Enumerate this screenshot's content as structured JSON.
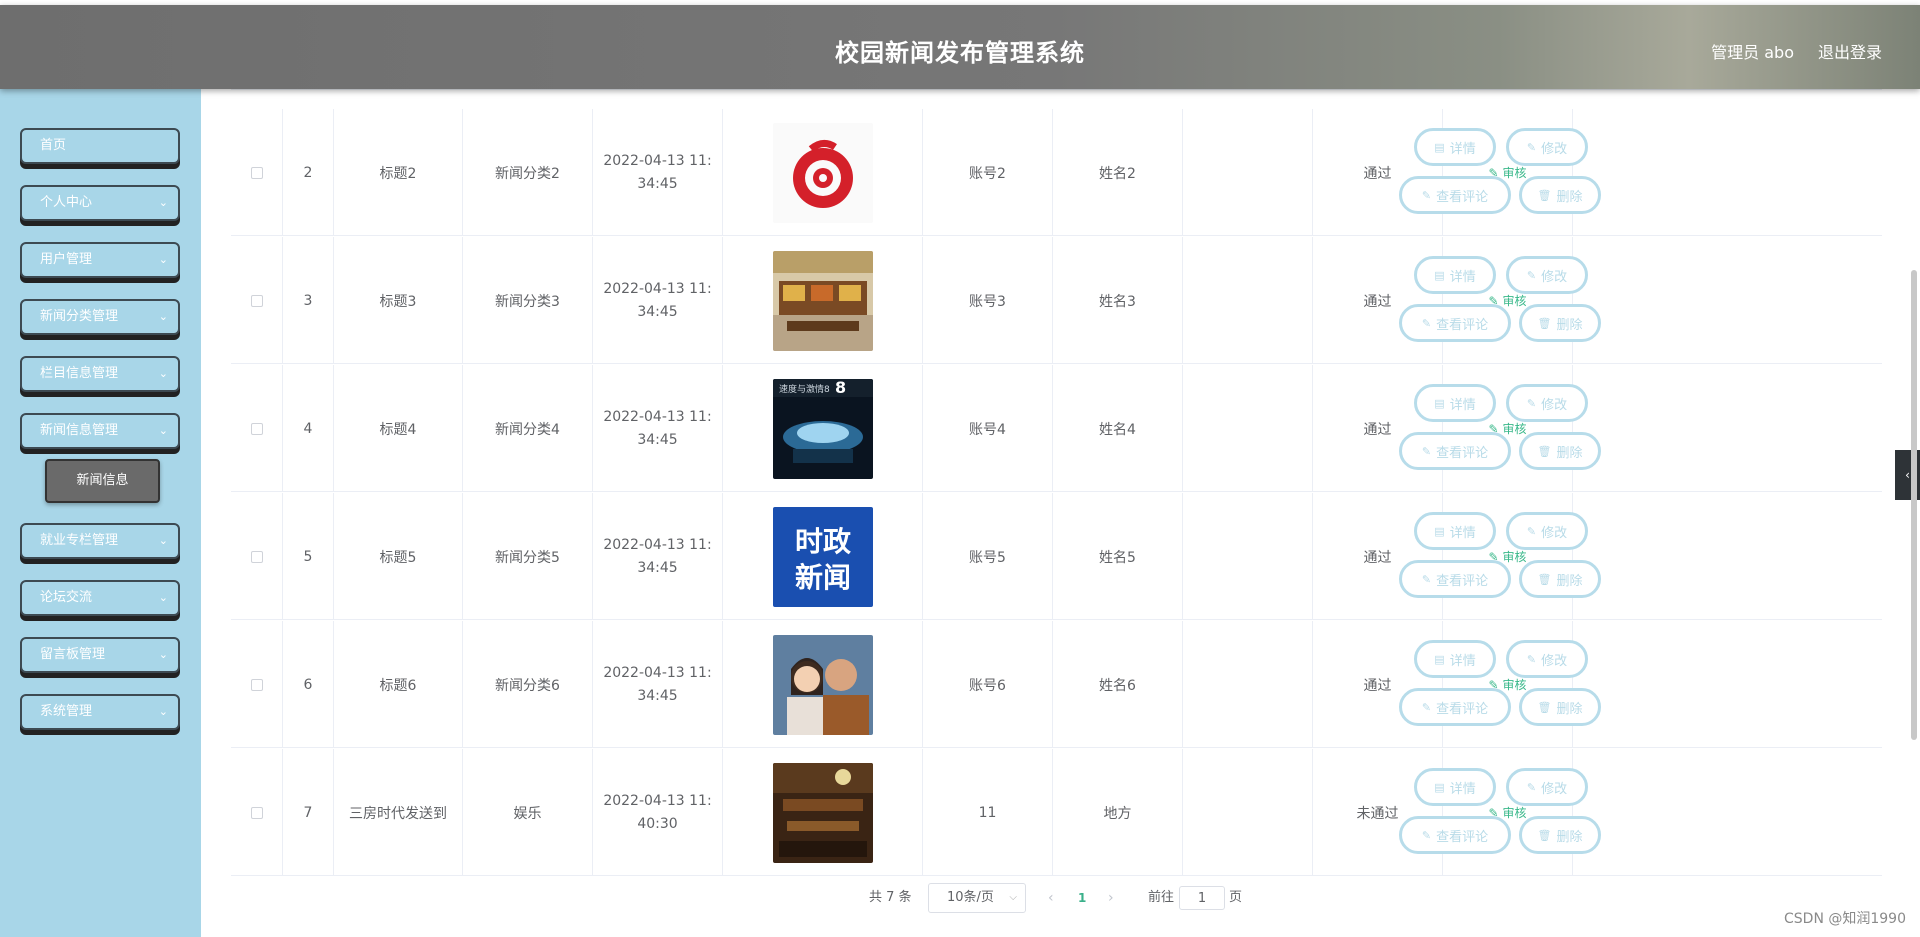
{
  "header": {
    "title": "校园新闻发布管理系统",
    "user": "管理员 abo",
    "logout": "退出登录"
  },
  "sidebar": {
    "items": [
      {
        "label": "首页",
        "has_chevron": false
      },
      {
        "label": "个人中心",
        "has_chevron": true
      },
      {
        "label": "用户管理",
        "has_chevron": true
      },
      {
        "label": "新闻分类管理",
        "has_chevron": true
      },
      {
        "label": "栏目信息管理",
        "has_chevron": true
      },
      {
        "label": "新闻信息管理",
        "has_chevron": true
      },
      {
        "label": "就业专栏管理",
        "has_chevron": true
      },
      {
        "label": "论坛交流",
        "has_chevron": true
      },
      {
        "label": "留言板管理",
        "has_chevron": true
      },
      {
        "label": "系统管理",
        "has_chevron": true
      }
    ],
    "sub_item": "新闻信息"
  },
  "table": {
    "rows": [
      {
        "index": "2",
        "title": "标题2",
        "category": "新闻分类2",
        "time1": "2022-04-13 11:",
        "time2": "34:45",
        "account": "账号2",
        "name": "姓名2",
        "status": "通过",
        "image": "netease-logo"
      },
      {
        "index": "3",
        "title": "标题3",
        "category": "新闻分类3",
        "time1": "2022-04-13 11:",
        "time2": "34:45",
        "account": "账号3",
        "name": "姓名3",
        "status": "通过",
        "image": "food-court"
      },
      {
        "index": "4",
        "title": "标题4",
        "category": "新闻分类4",
        "time1": "2022-04-13 11:",
        "time2": "34:45",
        "account": "账号4",
        "name": "姓名4",
        "status": "通过",
        "image": "movie-poster"
      },
      {
        "index": "5",
        "title": "标题5",
        "category": "新闻分类5",
        "time1": "2022-04-13 11:",
        "time2": "34:45",
        "account": "账号5",
        "name": "姓名5",
        "status": "通过",
        "image": "politics-news"
      },
      {
        "index": "6",
        "title": "标题6",
        "category": "新闻分类6",
        "time1": "2022-04-13 11:",
        "time2": "34:45",
        "account": "账号6",
        "name": "姓名6",
        "status": "通过",
        "image": "two-people"
      },
      {
        "index": "7",
        "title": "三房时代发送到",
        "category": "娱乐",
        "time1": "2022-04-13 11:",
        "time2": "40:30",
        "account": "11",
        "name": "地方",
        "status": "未通过",
        "image": "restaurant"
      }
    ],
    "audit_label": "审核",
    "buttons": {
      "detail": "详情",
      "edit": "修改",
      "comments": "查看评论",
      "delete": "删除"
    }
  },
  "poster_text": "速度与激情8",
  "politics_text": {
    "line1": "时政",
    "line2": "新闻"
  },
  "pagination": {
    "total": "共 7 条",
    "page_size": "10条/页",
    "current": "1",
    "goto_label": "前往",
    "goto_value": "1",
    "page_unit": "页"
  },
  "watermark": "CSDN @知润1990"
}
